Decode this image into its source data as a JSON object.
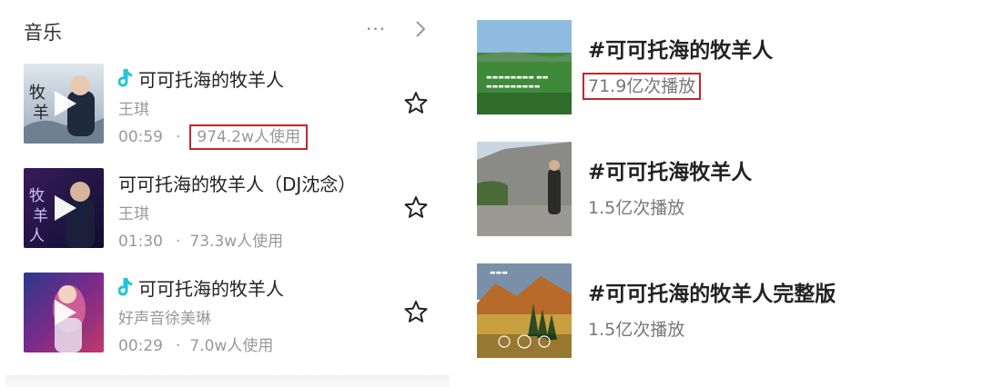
{
  "music_section": {
    "title": "音乐",
    "more_icon": "ellipsis-icon",
    "chevron_icon": "chevron-right-icon",
    "songs": [
      {
        "title": "可可托海的牧羊人",
        "artist": "王琪",
        "duration": "00:59",
        "usage": "974.2w人使用",
        "has_note_icon": true,
        "usage_highlighted": true
      },
      {
        "title": "可可托海的牧羊人（DJ沈念）",
        "artist": "王琪",
        "duration": "01:30",
        "usage": "73.3w人使用",
        "has_note_icon": false,
        "usage_highlighted": false
      },
      {
        "title": "可可托海的牧羊人",
        "artist": "好声音徐美琳",
        "duration": "00:29",
        "usage": "7.0w人使用",
        "has_note_icon": true,
        "usage_highlighted": false
      }
    ],
    "separator": "·"
  },
  "topics": [
    {
      "title": "#可可托海的牧羊人",
      "plays": "71.9亿次播放",
      "plays_highlighted": true
    },
    {
      "title": "#可可托海牧羊人",
      "plays": "1.5亿次播放",
      "plays_highlighted": false
    },
    {
      "title": "#可可托海的牧羊人完整版",
      "plays": "1.5亿次播放",
      "plays_highlighted": false
    }
  ],
  "colors": {
    "highlight_border": "#c0282a",
    "note_icon": "#22c4d8",
    "secondary_text": "#999999"
  }
}
